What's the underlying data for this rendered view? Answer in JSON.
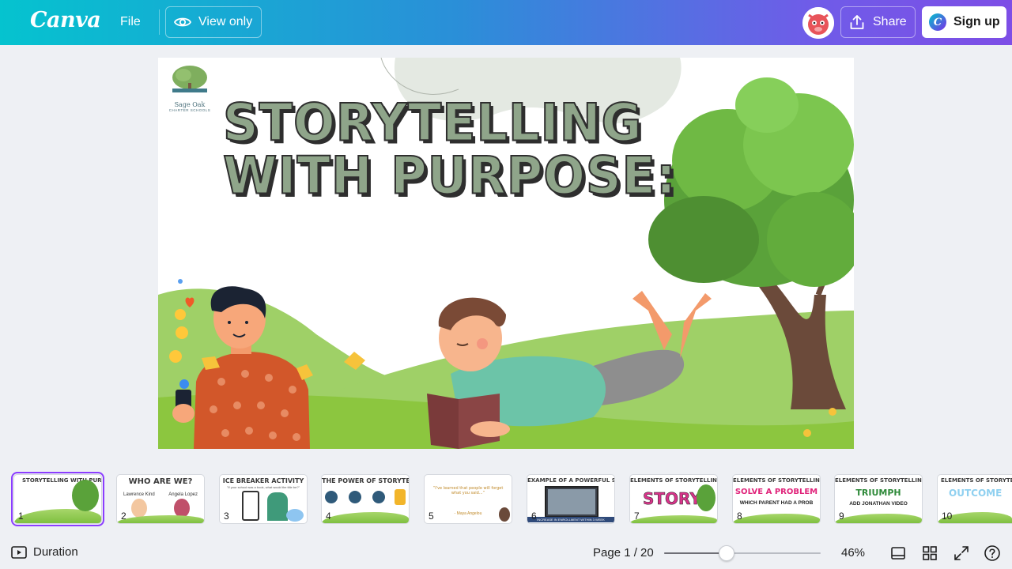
{
  "header": {
    "logo": "Canva",
    "file_label": "File",
    "view_only_label": "View only",
    "share_label": "Share",
    "signup_label": "Sign up",
    "signup_badge": "C"
  },
  "slide": {
    "title_line1": "STORYTELLING",
    "title_line2": "WITH PURPOSE:",
    "school_name": "Sage Oak",
    "school_sub": "CHARTER SCHOOLS"
  },
  "thumbnails": [
    {
      "num": "1",
      "title": "STORYTELLING WITH PURPOSE:",
      "active": true
    },
    {
      "num": "2",
      "title": "WHO ARE WE?"
    },
    {
      "num": "3",
      "title": "ICE BREAKER ACTIVITY"
    },
    {
      "num": "4",
      "title": "THE POWER OF STORYTELLING"
    },
    {
      "num": "5",
      "title": "“I've learned that people will forget what you said...”"
    },
    {
      "num": "6",
      "title": "EXAMPLE OF A POWERFUL STORY"
    },
    {
      "num": "7",
      "title": "ELEMENTS OF STORYTELLING"
    },
    {
      "num": "8",
      "title": "ELEMENTS OF STORYTELLING"
    },
    {
      "num": "9",
      "title": "ELEMENTS OF STORYTELLING"
    },
    {
      "num": "10",
      "title": "ELEMENTS OF STORYTELLING"
    }
  ],
  "thumb_details": {
    "t2_left": "Lawrence Kind",
    "t2_right": "Angela Lopez",
    "t3_sub": "\"If your school was a book, what would the title be?\"",
    "t5_author": "- Maya Angelou",
    "t6_caption": "INCREASE IN ENROLLMENT WITHIN 3 WEEK",
    "t7_word": "STORY",
    "t8_word": "SOLVE A PROBLEM",
    "t8_sub": "WHICH PARENT HAD A PROB",
    "t9_word": "TRIUMPH",
    "t9_sub": "ADD JONATHAN VIDEO",
    "t10_word": "OUTCOME"
  },
  "bottombar": {
    "duration_label": "Duration",
    "page_indicator": "Page 1 / 20",
    "zoom_value": "46%",
    "zoom_fraction": 0.4
  },
  "colors": {
    "accent": "#8b3dff",
    "title_fill": "#8fa58a",
    "grass": "#8cc63f"
  }
}
